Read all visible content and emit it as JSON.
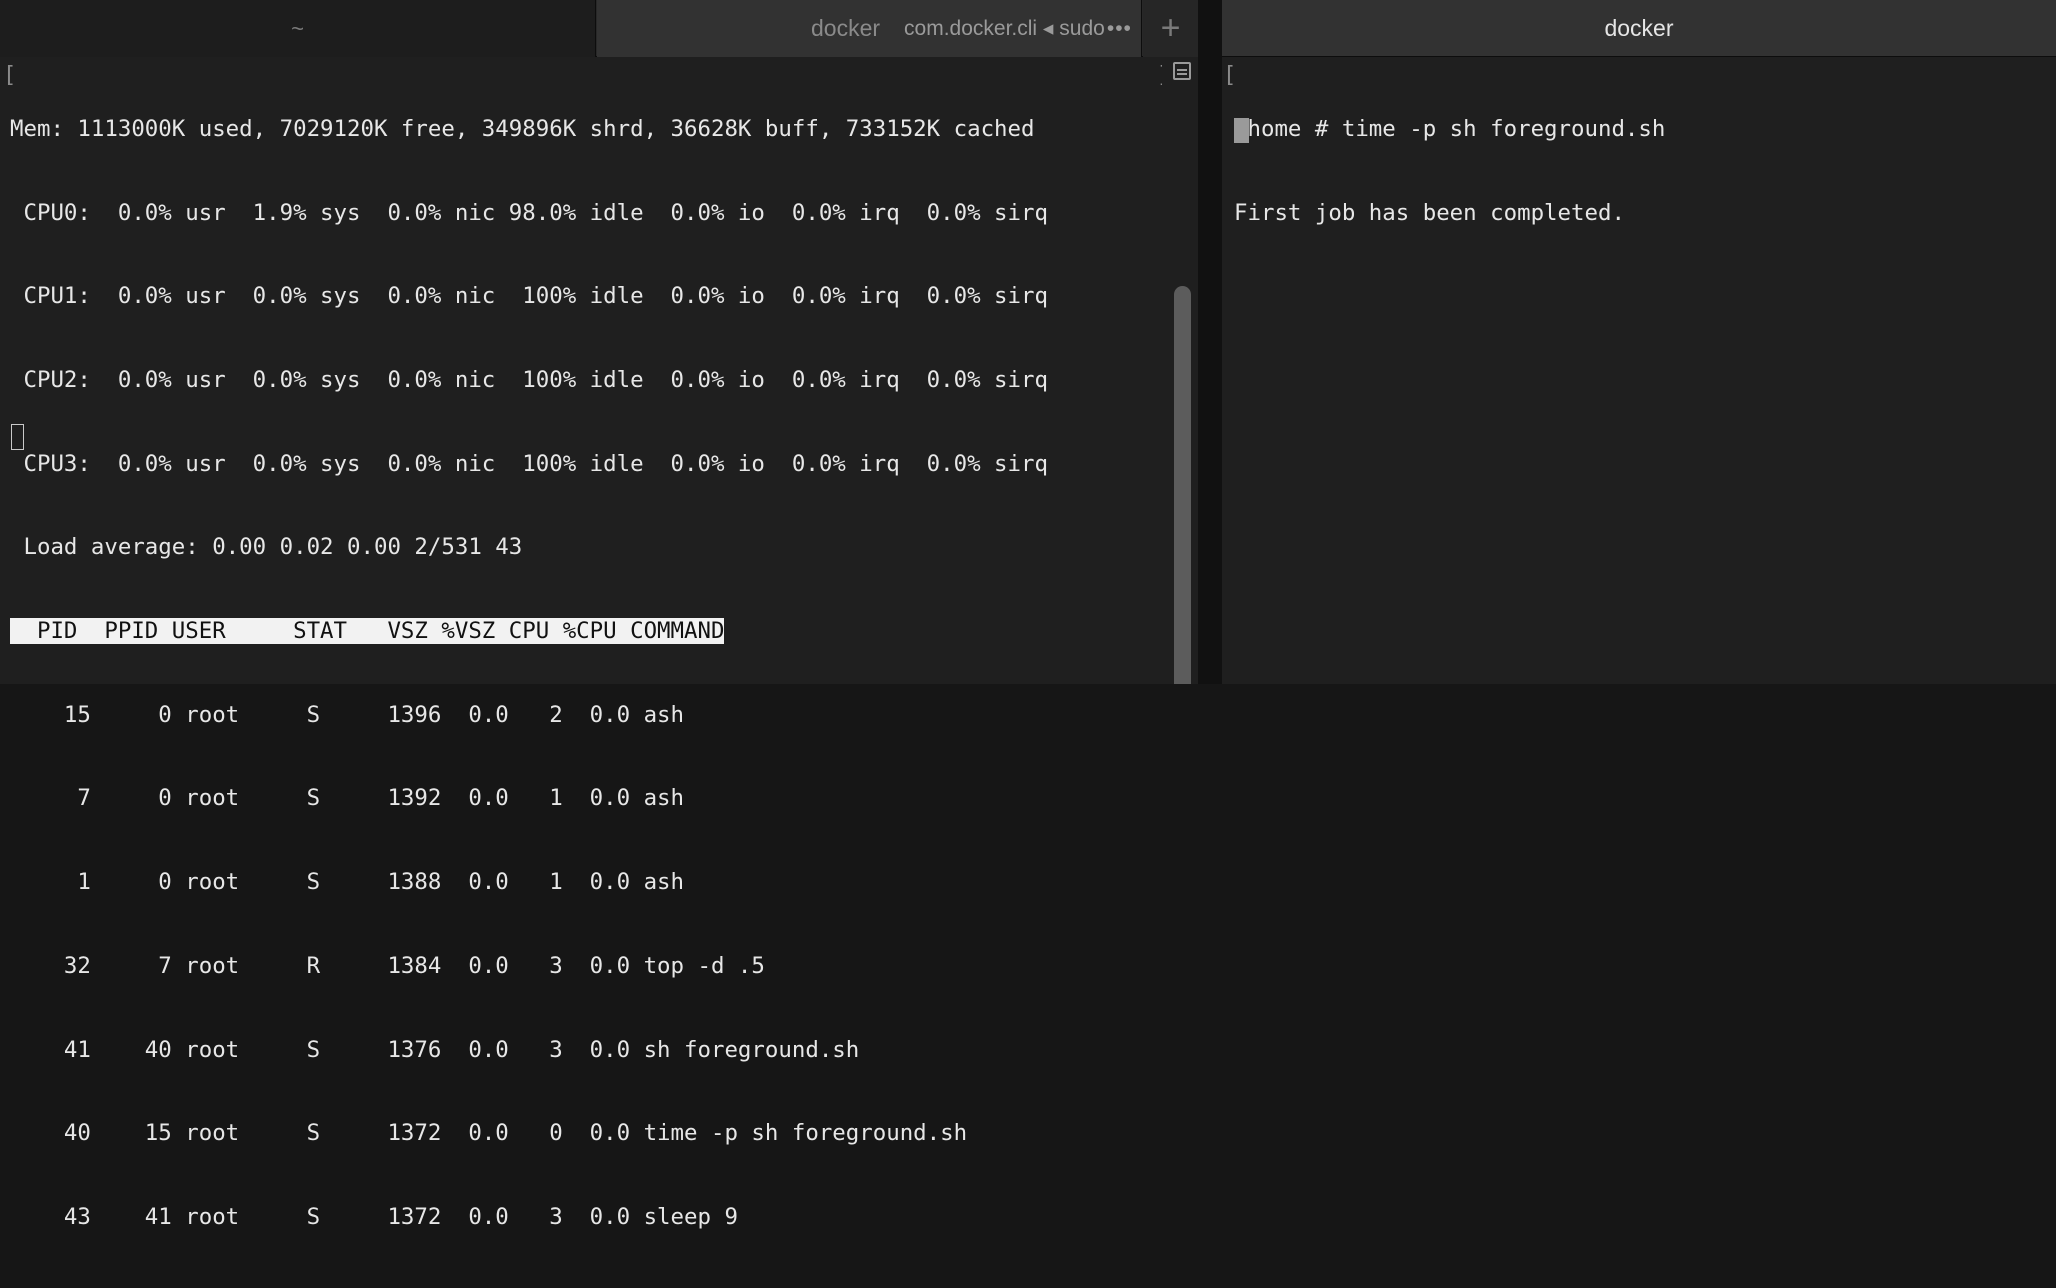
{
  "left_window": {
    "tabs": {
      "home_label": "~",
      "docker_label": "docker",
      "docker_subtitle": "com.docker.cli ◂ sudo",
      "docker_more": "•••",
      "add_label": "+"
    },
    "bracket_left": "[",
    "bracket_right": "]",
    "top": {
      "mem": "Mem: 1113000K used, 7029120K free, 349896K shrd, 36628K buff, 733152K cached",
      "cpu": [
        " CPU0:  0.0% usr  1.9% sys  0.0% nic 98.0% idle  0.0% io  0.0% irq  0.0% sirq",
        " CPU1:  0.0% usr  0.0% sys  0.0% nic  100% idle  0.0% io  0.0% irq  0.0% sirq",
        " CPU2:  0.0% usr  0.0% sys  0.0% nic  100% idle  0.0% io  0.0% irq  0.0% sirq",
        " CPU3:  0.0% usr  0.0% sys  0.0% nic  100% idle  0.0% io  0.0% irq  0.0% sirq"
      ],
      "load": " Load average: 0.00 0.02 0.00 2/531 43",
      "header": "  PID  PPID USER     STAT   VSZ %VSZ CPU %CPU COMMAND",
      "processes": [
        "    15     0 root     S     1396  0.0   2  0.0 ash",
        "     7     0 root     S     1392  0.0   1  0.0 ash",
        "     1     0 root     S     1388  0.0   1  0.0 ash",
        "    32     7 root     R     1384  0.0   3  0.0 top -d .5",
        "    41    40 root     S     1376  0.0   3  0.0 sh foreground.sh",
        "    40    15 root     S     1372  0.0   0  0.0 time -p sh foreground.sh",
        "    43    41 root     S     1372  0.0   3  0.0 sleep 9"
      ]
    }
  },
  "right_window": {
    "title": "docker",
    "bracket_left": "[",
    "lines": [
      "/home # time -p sh foreground.sh",
      "First job has been completed."
    ]
  }
}
